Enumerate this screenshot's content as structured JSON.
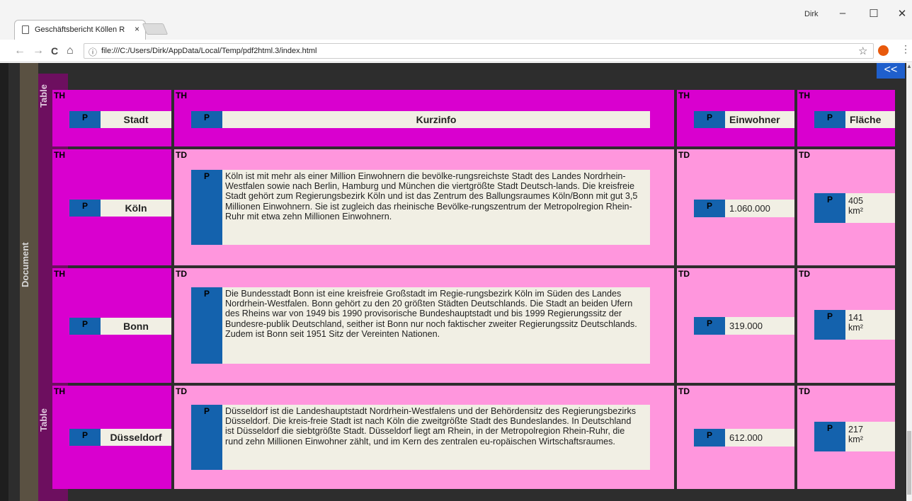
{
  "browser": {
    "tab_title": "Geschäftsbericht Köllen R",
    "tab_close": "×",
    "user": "Dirk",
    "minimize": "–",
    "maximize": "☐",
    "close": "✕",
    "back": "←",
    "forward": "→",
    "reload": "C",
    "home": "⌂",
    "info": "ⓘ",
    "url": "file:///C:/Users/Dirk/AppData/Local/Temp/pdf2html.3/index.html",
    "bookmark": "☆",
    "menu": "⋮"
  },
  "viewer": {
    "document_label": "Document",
    "table_label_top": "Table",
    "table_label_bottom": "Table",
    "back_button": "<<"
  },
  "table": {
    "headers": [
      {
        "tag": "TH",
        "ptag": "P",
        "text": "Stadt"
      },
      {
        "tag": "TH",
        "ptag": "P",
        "text": "Kurzinfo"
      },
      {
        "tag": "TH",
        "ptag": "P",
        "text": "Einwohner"
      },
      {
        "tag": "TH",
        "ptag": "P",
        "text": "Fläche"
      }
    ],
    "rows": [
      {
        "city_tag": "TH",
        "city": "Köln",
        "info_tag": "TD",
        "info": "Köln ist mit mehr als einer Million Einwohnern die bevölke-rungsreichste Stadt des Landes Nordrhein-Westfalen sowie nach Berlin, Hamburg und München die viertgrößte Stadt Deutsch-lands. Die kreisfreie Stadt gehört zum Regierungsbezirk Köln und ist das Zentrum des Ballungsraumes Köln/Bonn mit gut 3,5 Millionen Einwohnern. Sie ist zugleich das rheinische Bevölke-rungszentrum der Metropolregion Rhein-Ruhr mit etwa zehn Millionen Einwohnern.",
        "pop_tag": "TD",
        "population": "1.060.000",
        "area_tag": "TD",
        "area_value": "405",
        "area_unit": "km²"
      },
      {
        "city_tag": "TH",
        "city": "Bonn",
        "info_tag": "TD",
        "info": "Die Bundesstadt Bonn ist eine kreisfreie Großstadt im Regie-rungsbezirk Köln im Süden des Landes Nordrhein-Westfalen. Bonn gehört zu den 20 größten Städten Deutschlands. Die Stadt an beiden Ufern des Rheins war von 1949 bis 1990 provisorische Bundeshauptstadt und bis 1999 Regierungssitz der Bundesre-publik Deutschland, seither ist Bonn nur noch faktischer zweiter Regierungssitz Deutschlands. Zudem ist Bonn seit 1951 Sitz der Vereinten Nationen.",
        "pop_tag": "TD",
        "population": "319.000",
        "area_tag": "TD",
        "area_value": "141",
        "area_unit": "km²"
      },
      {
        "city_tag": "TH",
        "city": "Düsseldorf",
        "info_tag": "TD",
        "info": "Düsseldorf ist die Landeshauptstadt Nordrhein-Westfalens und der Behördensitz des Regierungsbezirks Düsseldorf. Die kreis-freie Stadt ist nach Köln die zweitgrößte Stadt des Bundeslandes. In Deutschland ist Düsseldorf die siebtgrößte Stadt. Düsseldorf liegt am Rhein, in der Metropolregion Rhein-Ruhr, die rund zehn Millionen Einwohner zählt, und im Kern des zentralen eu-ropäischen Wirtschaftsraumes.",
        "pop_tag": "TD",
        "population": "612.000",
        "area_tag": "TD",
        "area_value": "217",
        "area_unit": "km²"
      }
    ]
  }
}
